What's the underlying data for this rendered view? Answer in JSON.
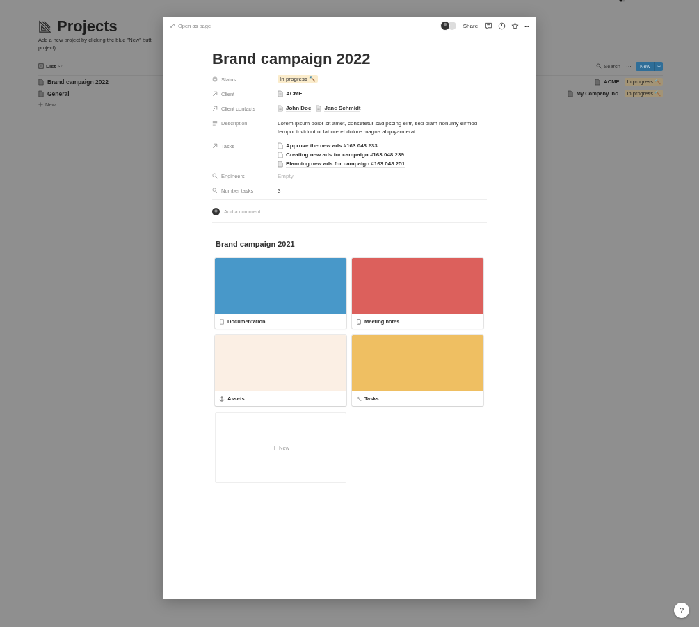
{
  "background_page": {
    "title": "Projects",
    "description_lines": [
      "Add a new project by clicking the blue \"New\" butt",
      "project)."
    ],
    "view": {
      "label": "List"
    },
    "toolbar": {
      "search": "Search",
      "more": "···",
      "new_button": "New"
    },
    "rows": [
      {
        "name": "Brand campaign 2022",
        "client": "ACME",
        "status": "In progress 🔨"
      },
      {
        "name": "General",
        "client": "My Company Inc.",
        "status": "In progress 🔨"
      }
    ],
    "add_new": "New"
  },
  "modal": {
    "open_as_page": "Open as page",
    "share": "Share",
    "more": "•••",
    "title": "Brand campaign 2022",
    "properties": [
      {
        "kind": "select",
        "label": "Status",
        "value": "In progress 🔨"
      },
      {
        "kind": "relation",
        "label": "Client",
        "items": [
          "ACME"
        ]
      },
      {
        "kind": "relation",
        "label": "Client contacts",
        "items": [
          "John Doe",
          "Jane Schmidt"
        ]
      },
      {
        "kind": "text",
        "label": "Description",
        "value": "Lorem ipsum dolor sit amet, consetetur sadipscing elitr, sed diam nonumy eirmod tempor invidunt ut labore et dolore magna aliquyam erat."
      },
      {
        "kind": "list",
        "label": "Tasks",
        "items": [
          "Approve the new ads #163.048.233",
          "Creating new ads for campaign #163.048.239",
          "Planning new ads for campaign #163.048.251"
        ]
      },
      {
        "kind": "rollup",
        "label": "Engineers",
        "value": "Empty",
        "empty": true
      },
      {
        "kind": "rollup",
        "label": "Number tasks",
        "value": "3",
        "empty": false
      }
    ],
    "comment": {
      "placeholder": "Add a comment..."
    },
    "section": {
      "title": "Brand campaign 2021",
      "cards": [
        {
          "title": "Documentation",
          "color": "#4898c9"
        },
        {
          "title": "Meeting notes",
          "color": "#dc605c"
        },
        {
          "title": "Assets",
          "color": "#fbefe4"
        },
        {
          "title": "Tasks",
          "color": "#efbf62"
        }
      ],
      "new_card": "New"
    }
  },
  "help_button": "?"
}
